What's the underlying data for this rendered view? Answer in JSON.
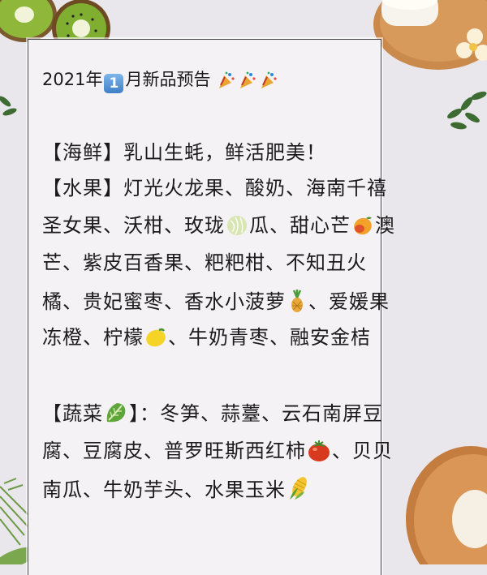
{
  "post": {
    "title": {
      "year_text": "2021年",
      "month_number": "1",
      "month_text": "月新品预告",
      "party_icon_count": 3
    },
    "seafood": {
      "text": "【海鲜】乳山生蚝，鲜活肥美！"
    },
    "fruit": {
      "line1": "【水果】灯光火龙果、酸奶、海南千禧",
      "line2_a": "圣女果、沃柑、玫珑",
      "line2_b": "瓜、甜心芒",
      "line2_c": "澳",
      "line3": "芒、紫皮百香果、粑粑柑、不知丑火",
      "line4_a": "橘、贵妃蜜枣、香水小菠萝",
      "line4_b": "、爱媛果",
      "line5_a": "冻橙、柠檬",
      "line5_b": "、牛奶青枣、融安金桔"
    },
    "vegetable": {
      "line1_a": "【蔬菜",
      "line1_b": "】：冬笋、蒜薹、云石南屏豆",
      "line2_a": "腐、豆腐皮、普罗旺斯西红柿",
      "line2_b": "、贝贝",
      "line3_a": "南瓜、牛奶芋头、水果玉米"
    },
    "icons": [
      "party-popper-icon",
      "melon-icon",
      "mango-icon",
      "pineapple-icon",
      "lemon-icon",
      "lettuce-icon",
      "tomato-icon",
      "corn-icon"
    ],
    "colors": {
      "background": "#e9e6ec",
      "card": "#f4f2f4",
      "text": "#1b1b1b",
      "kiwi_green": "#6b9b2a",
      "wood": "#c98a4c"
    }
  }
}
